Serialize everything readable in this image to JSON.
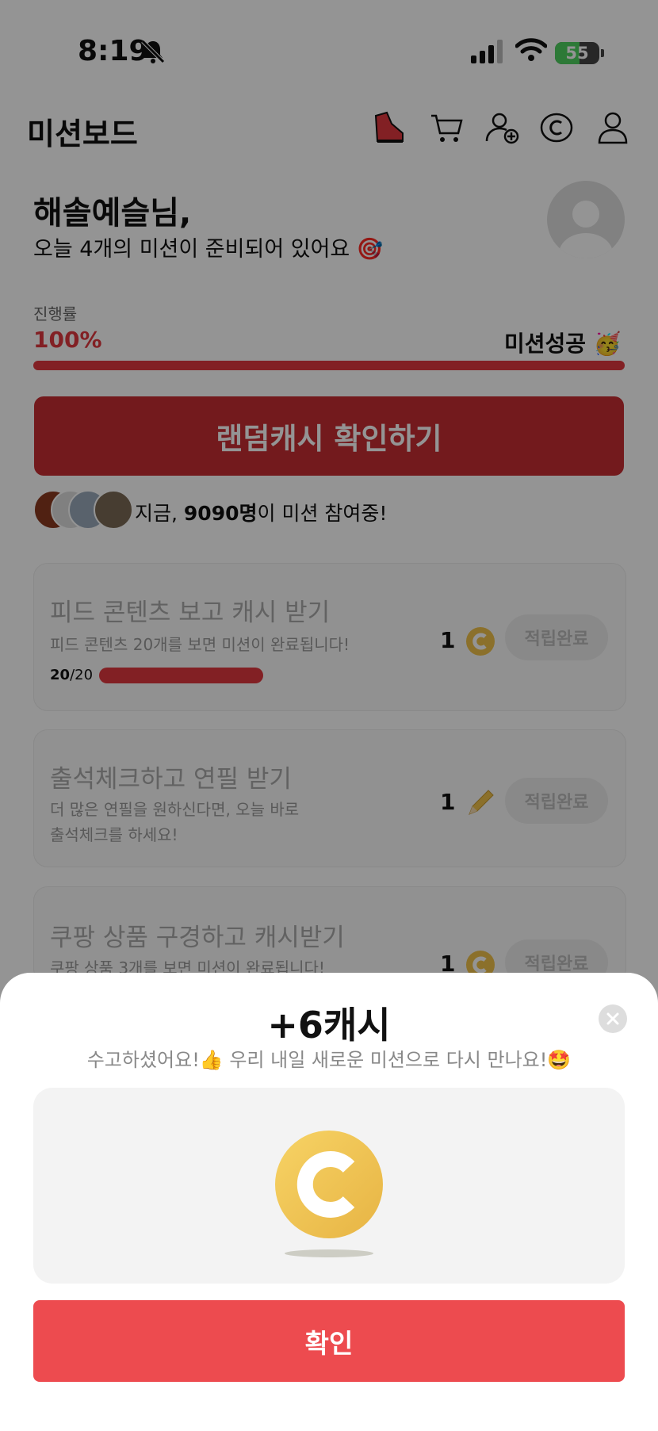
{
  "status_bar": {
    "time": "8:19",
    "battery": "55",
    "battery_level": 0.55
  },
  "header": {
    "title": "미션보드",
    "icons": [
      "sneaker-icon",
      "cart-icon",
      "add-user-icon",
      "coin-icon",
      "profile-icon"
    ]
  },
  "greeting": {
    "name": "해솔예슬님,",
    "subtitle": "오늘 4개의 미션이 준비되어 있어요 🎯"
  },
  "progress": {
    "label": "진행률",
    "percent": "100%",
    "percent_value": 100,
    "status": "미션성공 🥳"
  },
  "random_cash_button": "랜덤캐시 확인하기",
  "participants": {
    "prefix": "지금, ",
    "count": "9090명",
    "suffix": "이 미션 참여중!"
  },
  "missions": [
    {
      "title": "피드 콘텐츠 보고 캐시 받기",
      "desc": "피드 콘텐츠 20개를 보면 미션이 완료됩니다!",
      "done": "20",
      "total": "/20",
      "fraction": 1.0,
      "reward": "1",
      "reward_icon": "coin-icon",
      "button": "적립완료"
    },
    {
      "title": "출석체크하고 연필 받기",
      "desc": "더 많은 연필을 원하신다면, 오늘 바로\n출석체크를 하세요!",
      "reward": "1",
      "reward_icon": "pencil-icon",
      "button": "적립완료"
    },
    {
      "title": "쿠팡 상품 구경하고 캐시받기",
      "desc": "쿠팡 상품 3개를 보면 미션이 완료됩니다!",
      "reward": "1",
      "reward_icon": "coin-icon",
      "button": "적립완료"
    }
  ],
  "sheet": {
    "title": "+6캐시",
    "message": "수고하셨어요!👍 우리 내일 새로운 미션으로 다시 만나요!🤩",
    "confirm": "확인"
  },
  "colors": {
    "accent": "#e0383e",
    "confirm": "#ed4b4f",
    "coin": "#f0c24a"
  }
}
